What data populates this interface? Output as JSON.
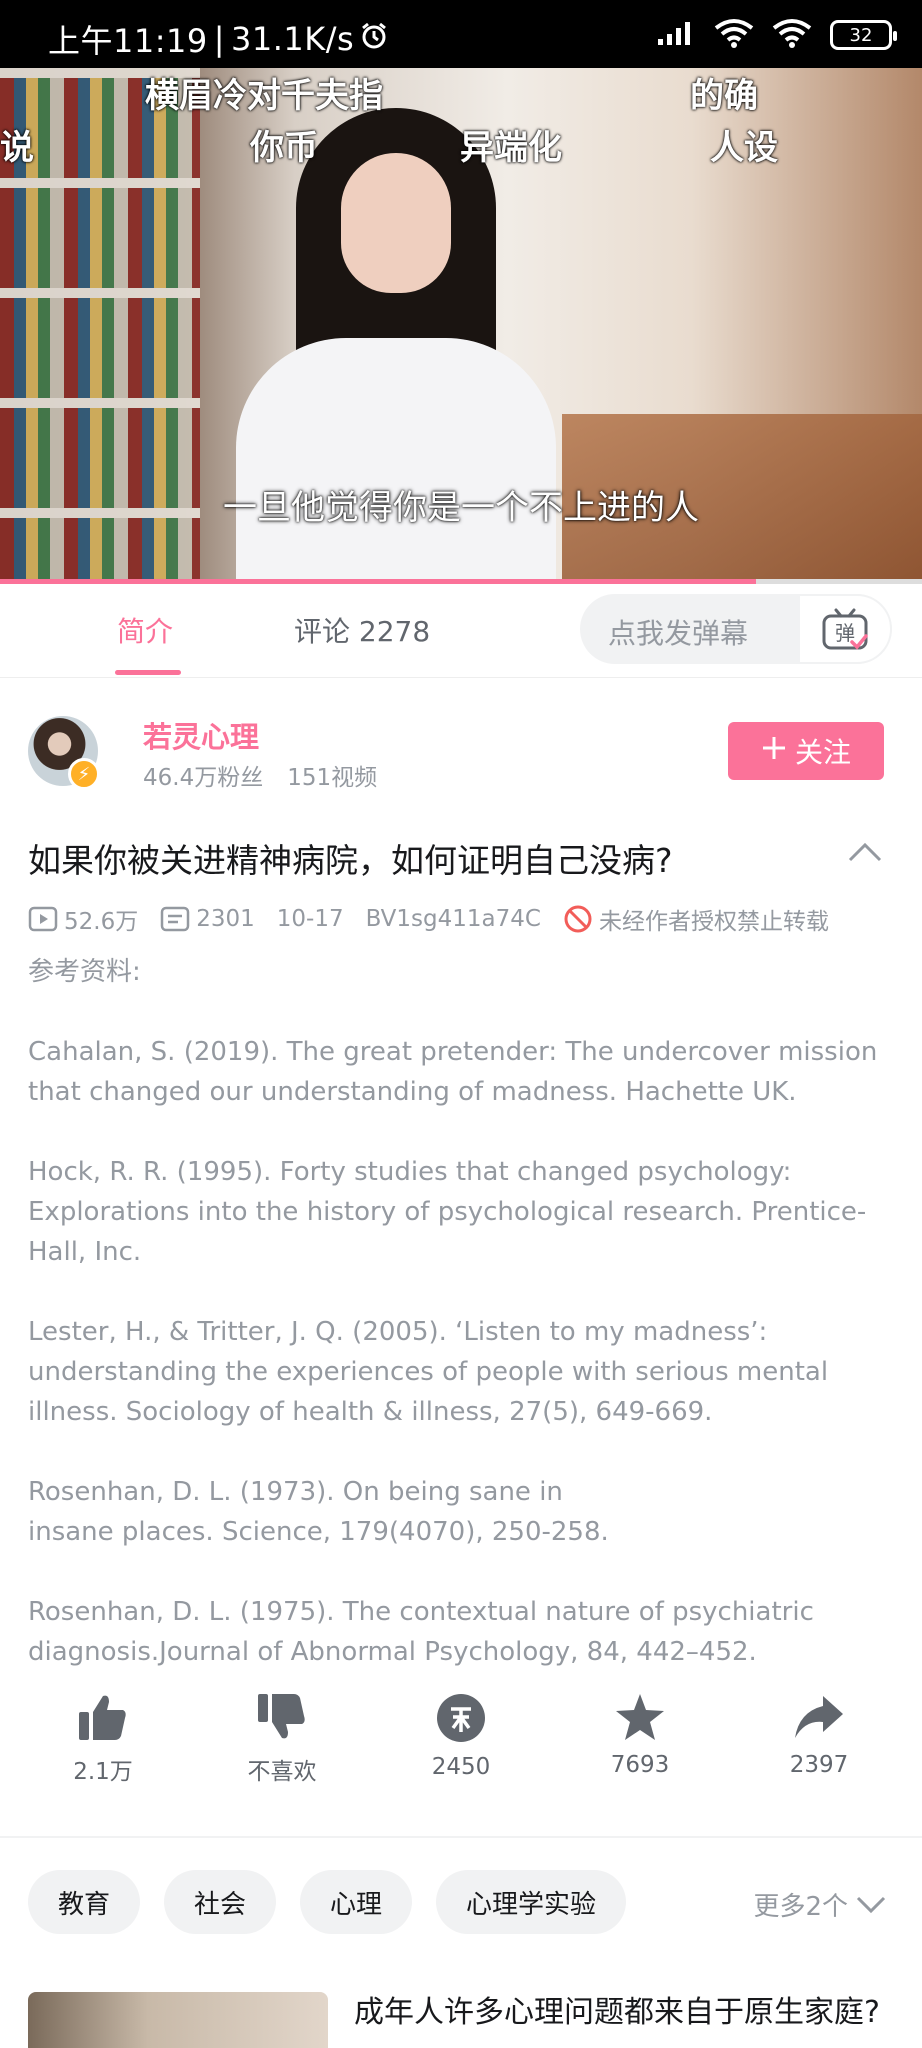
{
  "status_bar": {
    "time": "上午11:19",
    "speed": "31.1K/s",
    "battery": "32"
  },
  "video": {
    "danmaku": [
      "横眉冷对千夫指",
      "的确",
      "说",
      "你币",
      "异端化",
      "人设"
    ],
    "subtitle": "一旦他觉得你是一个不上进的人",
    "progress": 0.82
  },
  "tabs": {
    "intro": "简介",
    "comments": "评论 2278",
    "danmaku_placeholder": "点我发弹幕"
  },
  "uploader": {
    "name": "若灵心理",
    "fans": "46.4万粉丝",
    "videos": "151视频",
    "follow": "关注"
  },
  "video_info": {
    "title": "如果你被关进精神病院，如何证明自己没病?",
    "views": "52.6万",
    "danmaku_count": "2301",
    "date": "10-17",
    "bvid": "BV1sg411a74C",
    "copyright": "未经作者授权禁止转载"
  },
  "description": {
    "heading": "参考资料:",
    "refs": [
      "Cahalan, S. (2019). The great pretender: The undercover mission that changed our understanding of madness. Hachette UK.",
      "Hock, R. R. (1995). Forty studies that changed psychology: Explorations into the history of psychological research. Prentice-Hall, Inc.",
      "Lester, H., & Tritter, J. Q. (2005). ‘Listen to my madness’: understanding the experiences of people with serious mental illness. Sociology of health & illness, 27(5), 649-669.",
      "Rosenhan, D. L. (1973). On being sane in insane places. Science, 179(4070), 250-258.",
      "Rosenhan, D. L. (1975). The contextual nature of psychiatric diagnosis.Journal of Abnormal Psychology, 84, 442–452."
    ]
  },
  "actions": {
    "like": "2.1万",
    "dislike": "不喜欢",
    "coin": "2450",
    "favorite": "7693",
    "share": "2397"
  },
  "tags": {
    "items": [
      "教育",
      "社会",
      "心理",
      "心理学实验"
    ],
    "more": "更多2个"
  },
  "related": {
    "title": "成年人许多心理问题都来自于原生家庭?"
  },
  "colors": {
    "accent": "#fb7299",
    "text_secondary": "#9499a0"
  }
}
